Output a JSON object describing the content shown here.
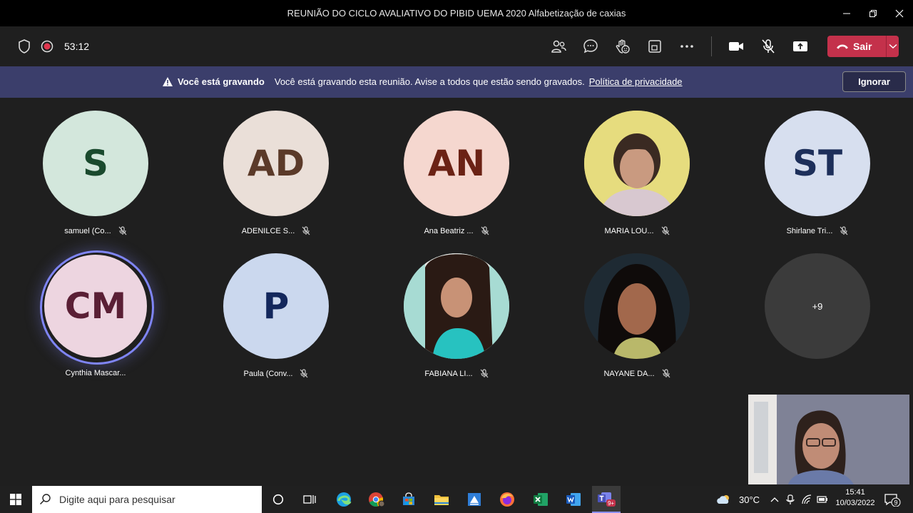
{
  "window": {
    "title": "REUNIÃO DO CICLO AVALIATIVO DO PIBID UEMA 2020 Alfabetização de caxias"
  },
  "toolbar": {
    "timer": "53:12",
    "leave_label": "Sair"
  },
  "banner": {
    "title": "Você está gravando",
    "message": "Você está gravando esta reunião. Avise a todos que estão sendo gravados.",
    "link": "Política de privacidade",
    "dismiss_label": "Ignorar"
  },
  "participants": [
    {
      "initials": "S",
      "name": "samuel (Co...",
      "bg": "#d3e7dc",
      "fg": "#1a4a2e",
      "muted": true
    },
    {
      "initials": "AD",
      "name": "ADENILCE S...",
      "bg": "#eadfd8",
      "fg": "#5b3a29",
      "muted": true
    },
    {
      "initials": "AN",
      "name": "Ana Beatriz ...",
      "bg": "#f5d7cf",
      "fg": "#6b2215",
      "muted": true
    },
    {
      "initials": "",
      "name": "MARIA LOU...",
      "bg": "#e8dd7a",
      "fg": "#000",
      "muted": true,
      "photo": true
    },
    {
      "initials": "ST",
      "name": "Shirlane Tri...",
      "bg": "#d7dfef",
      "fg": "#1d2f5a",
      "muted": true
    },
    {
      "initials": "CM",
      "name": "Cynthia Mascar...",
      "bg": "#edd5e0",
      "fg": "#5a1f35",
      "muted": false,
      "speaking": true
    },
    {
      "initials": "P",
      "name": "Paula (Conv...",
      "bg": "#cbd8ee",
      "fg": "#13275c",
      "muted": true
    },
    {
      "initials": "",
      "name": "FABIANA LI...",
      "bg": "#9fd8d0",
      "fg": "#000",
      "muted": true,
      "photo": true
    },
    {
      "initials": "",
      "name": "NAYANE DA...",
      "bg": "#3a2a24",
      "fg": "#000",
      "muted": true,
      "photo": true
    },
    {
      "initials": "+9",
      "name": "",
      "bg": "#3b3b3b",
      "fg": "#ffffff",
      "muted": false
    }
  ],
  "taskbar": {
    "search_placeholder": "Digite aqui para pesquisar",
    "temperature": "30°C",
    "time": "15:41",
    "date": "10/03/2022",
    "notification_count": "9",
    "teams_badge": "9+"
  }
}
